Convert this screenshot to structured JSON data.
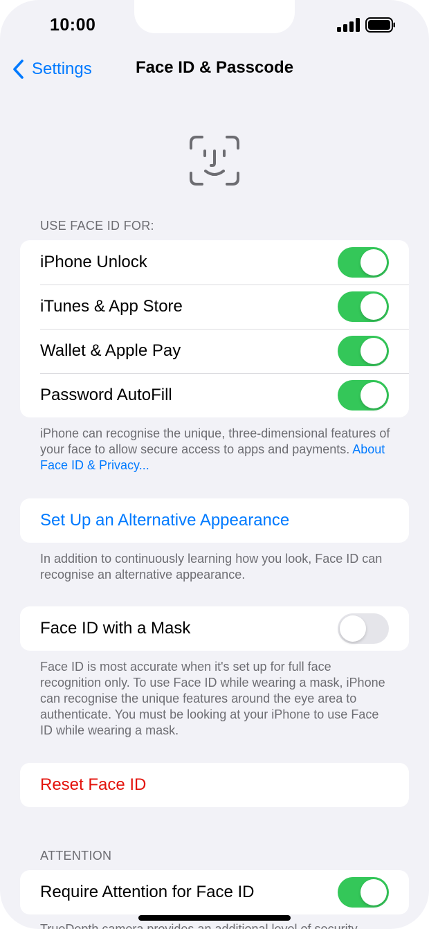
{
  "status_bar": {
    "time": "10:00"
  },
  "nav": {
    "back_label": "Settings",
    "title": "Face ID & Passcode"
  },
  "use_face_id": {
    "header": "USE FACE ID FOR:",
    "items": [
      {
        "label": "iPhone Unlock",
        "on": true
      },
      {
        "label": "iTunes & App Store",
        "on": true
      },
      {
        "label": "Wallet & Apple Pay",
        "on": true
      },
      {
        "label": "Password AutoFill",
        "on": true
      }
    ],
    "footer": "iPhone can recognise the unique, three-dimensional features of your face to allow secure access to apps and payments.",
    "footer_link": "About Face ID & Privacy..."
  },
  "alternative": {
    "label": "Set Up an Alternative Appearance",
    "footer": "In addition to continuously learning how you look, Face ID can recognise an alternative appearance."
  },
  "mask": {
    "label": "Face ID with a Mask",
    "on": false,
    "footer": "Face ID is most accurate when it's set up for full face recognition only. To use Face ID while wearing a mask, iPhone can recognise the unique features around the eye area to authenticate. You must be looking at your iPhone to use Face ID while wearing a mask."
  },
  "reset": {
    "label": "Reset Face ID"
  },
  "attention": {
    "header": "ATTENTION",
    "label": "Require Attention for Face ID",
    "on": true,
    "footer": "TrueDepth camera provides an additional level of security"
  },
  "colors": {
    "accent": "#007aff",
    "toggle_on": "#34c759",
    "danger": "#e3120b"
  }
}
